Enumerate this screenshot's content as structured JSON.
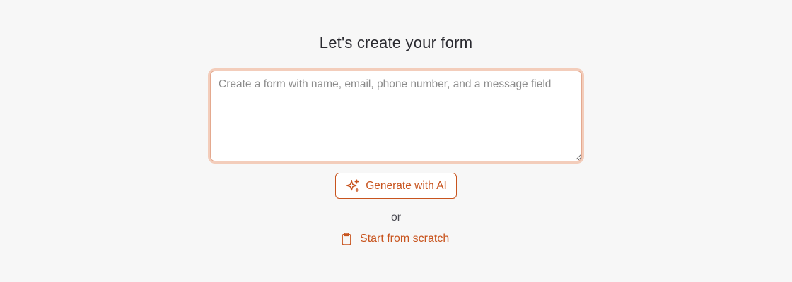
{
  "header": {
    "title": "Let's create your form"
  },
  "prompt": {
    "placeholder": "Create a form with name, email, phone number, and a message field",
    "value": ""
  },
  "actions": {
    "generate_label": "Generate with AI",
    "generate_icon": "sparkles-icon",
    "separator": "or",
    "scratch_label": "Start from scratch",
    "scratch_icon": "clipboard-icon"
  },
  "colors": {
    "accent": "#c8541e",
    "focus_ring": "#f3cdbb",
    "background": "#f7f7f7"
  }
}
